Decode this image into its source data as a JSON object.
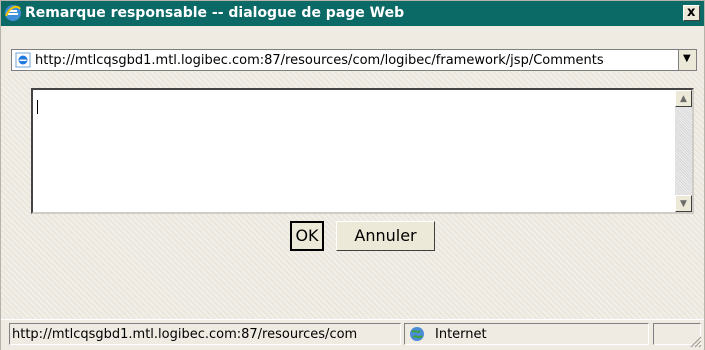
{
  "window": {
    "title": "Remarque responsable -- dialogue de page Web",
    "close_label": "x"
  },
  "address": {
    "url": "http://mtlcqsgbd1.mtl.logibec.com:87/resources/com/logibec/framework/jsp/Comments"
  },
  "comment": {
    "value": ""
  },
  "buttons": {
    "ok": "OK",
    "cancel": "Annuler"
  },
  "status": {
    "url": "http://mtlcqsgbd1.mtl.logibec.com:87/resources/com",
    "zone": "Internet"
  },
  "icons": {
    "title": "ie-icon",
    "address": "ie-page-icon",
    "zone": "globe-icon"
  },
  "colors": {
    "titlebar": "#0b6a66",
    "dialog_background": "#efebe3"
  }
}
